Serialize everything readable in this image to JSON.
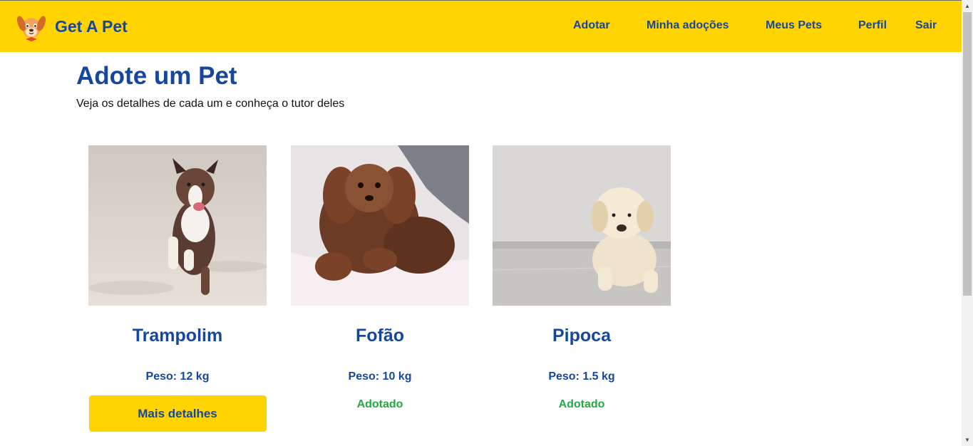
{
  "app": {
    "name": "Get A Pet",
    "logo_icon": "dog-face-icon"
  },
  "nav": {
    "items": [
      {
        "label": "Adotar"
      },
      {
        "label": "Minha adoções"
      },
      {
        "label": "Meus Pets"
      },
      {
        "label": "Perfil"
      },
      {
        "label": "Sair"
      }
    ]
  },
  "page": {
    "title": "Adote um Pet",
    "subtitle": "Veja os detalhes de cada um e conheça o tutor deles"
  },
  "pets": [
    {
      "name": "Trampolim",
      "weight": "Peso: 12 kg",
      "action_label": "Mais detalhes",
      "photo": "dog-running-on-sand"
    },
    {
      "name": "Fofão",
      "weight": "Peso: 10 kg",
      "status": "Adotado",
      "photo": "brown-curly-dog-on-bed"
    },
    {
      "name": "Pipoca",
      "weight": "Peso: 1.5 kg",
      "status": "Adotado",
      "photo": "cream-puppy-on-floor"
    }
  ],
  "colors": {
    "accent": "#FFD400",
    "primary_text": "#16479d",
    "adopted": "#27a745"
  }
}
